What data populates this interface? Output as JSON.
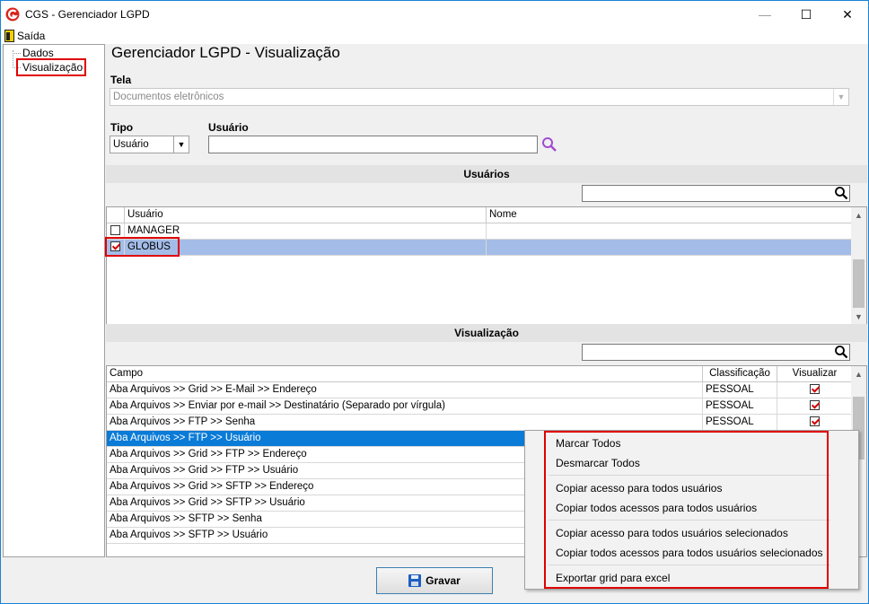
{
  "window": {
    "title": "CGS - Gerenciador LGPD",
    "minimize": "—",
    "maximize": "☐",
    "close": "✕"
  },
  "menu": {
    "saida": "Saída"
  },
  "tree": {
    "items": [
      "Dados",
      "Visualização"
    ]
  },
  "page": {
    "title": "Gerenciador LGPD - Visualização"
  },
  "filters": {
    "tela_label": "Tela",
    "tela_value": "Documentos eletrônicos",
    "tipo_label": "Tipo",
    "tipo_value": "Usuário",
    "usuario_label": "Usuário",
    "usuario_value": ""
  },
  "usuarios": {
    "section_title": "Usuários",
    "columns": [
      "Usuário",
      "Nome"
    ],
    "rows": [
      {
        "checked": false,
        "usuario": "MANAGER",
        "nome": ""
      },
      {
        "checked": true,
        "usuario": "GLOBUS",
        "nome": ""
      }
    ]
  },
  "visualizacao": {
    "section_title": "Visualização",
    "columns": [
      "Campo",
      "Classificação",
      "Visualizar"
    ],
    "rows": [
      {
        "campo": "Aba Arquivos >> Grid >> E-Mail >> Endereço",
        "classificacao": "PESSOAL",
        "visualizar": true
      },
      {
        "campo": "Aba Arquivos >> Enviar por e-mail >> Destinatário (Separado por vírgula)",
        "classificacao": "PESSOAL",
        "visualizar": true
      },
      {
        "campo": "Aba Arquivos >> FTP >> Senha",
        "classificacao": "PESSOAL",
        "visualizar": true
      },
      {
        "campo": "Aba Arquivos >> FTP >> Usuário",
        "classificacao": "",
        "visualizar": null
      },
      {
        "campo": "Aba Arquivos >> Grid >> FTP >>  Endereço",
        "classificacao": "",
        "visualizar": null
      },
      {
        "campo": "Aba Arquivos >> Grid >> FTP >> Usuário",
        "classificacao": "",
        "visualizar": null
      },
      {
        "campo": "Aba Arquivos >> Grid >> SFTP >> Endereço",
        "classificacao": "",
        "visualizar": null
      },
      {
        "campo": "Aba Arquivos >> Grid >> SFTP >> Usuário",
        "classificacao": "",
        "visualizar": null
      },
      {
        "campo": "Aba Arquivos >> SFTP >> Senha",
        "classificacao": "",
        "visualizar": null
      },
      {
        "campo": "Aba Arquivos >> SFTP >> Usuário",
        "classificacao": "",
        "visualizar": null
      }
    ]
  },
  "context_menu": {
    "items": [
      "Marcar Todos",
      "Desmarcar Todos",
      "Copiar acesso para todos usuários",
      "Copiar todos acessos para todos usuários",
      "Copiar acesso para todos usuários selecionados",
      "Copiar todos acessos para todos usuários selecionados",
      "Exportar grid para excel"
    ]
  },
  "buttons": {
    "gravar": "Gravar"
  },
  "colors": {
    "selection_blue": "#a4bde8",
    "selection_dark": "#0a7bd7",
    "highlight_red": "#e00000",
    "search_icon_user": "#a24bd1"
  }
}
